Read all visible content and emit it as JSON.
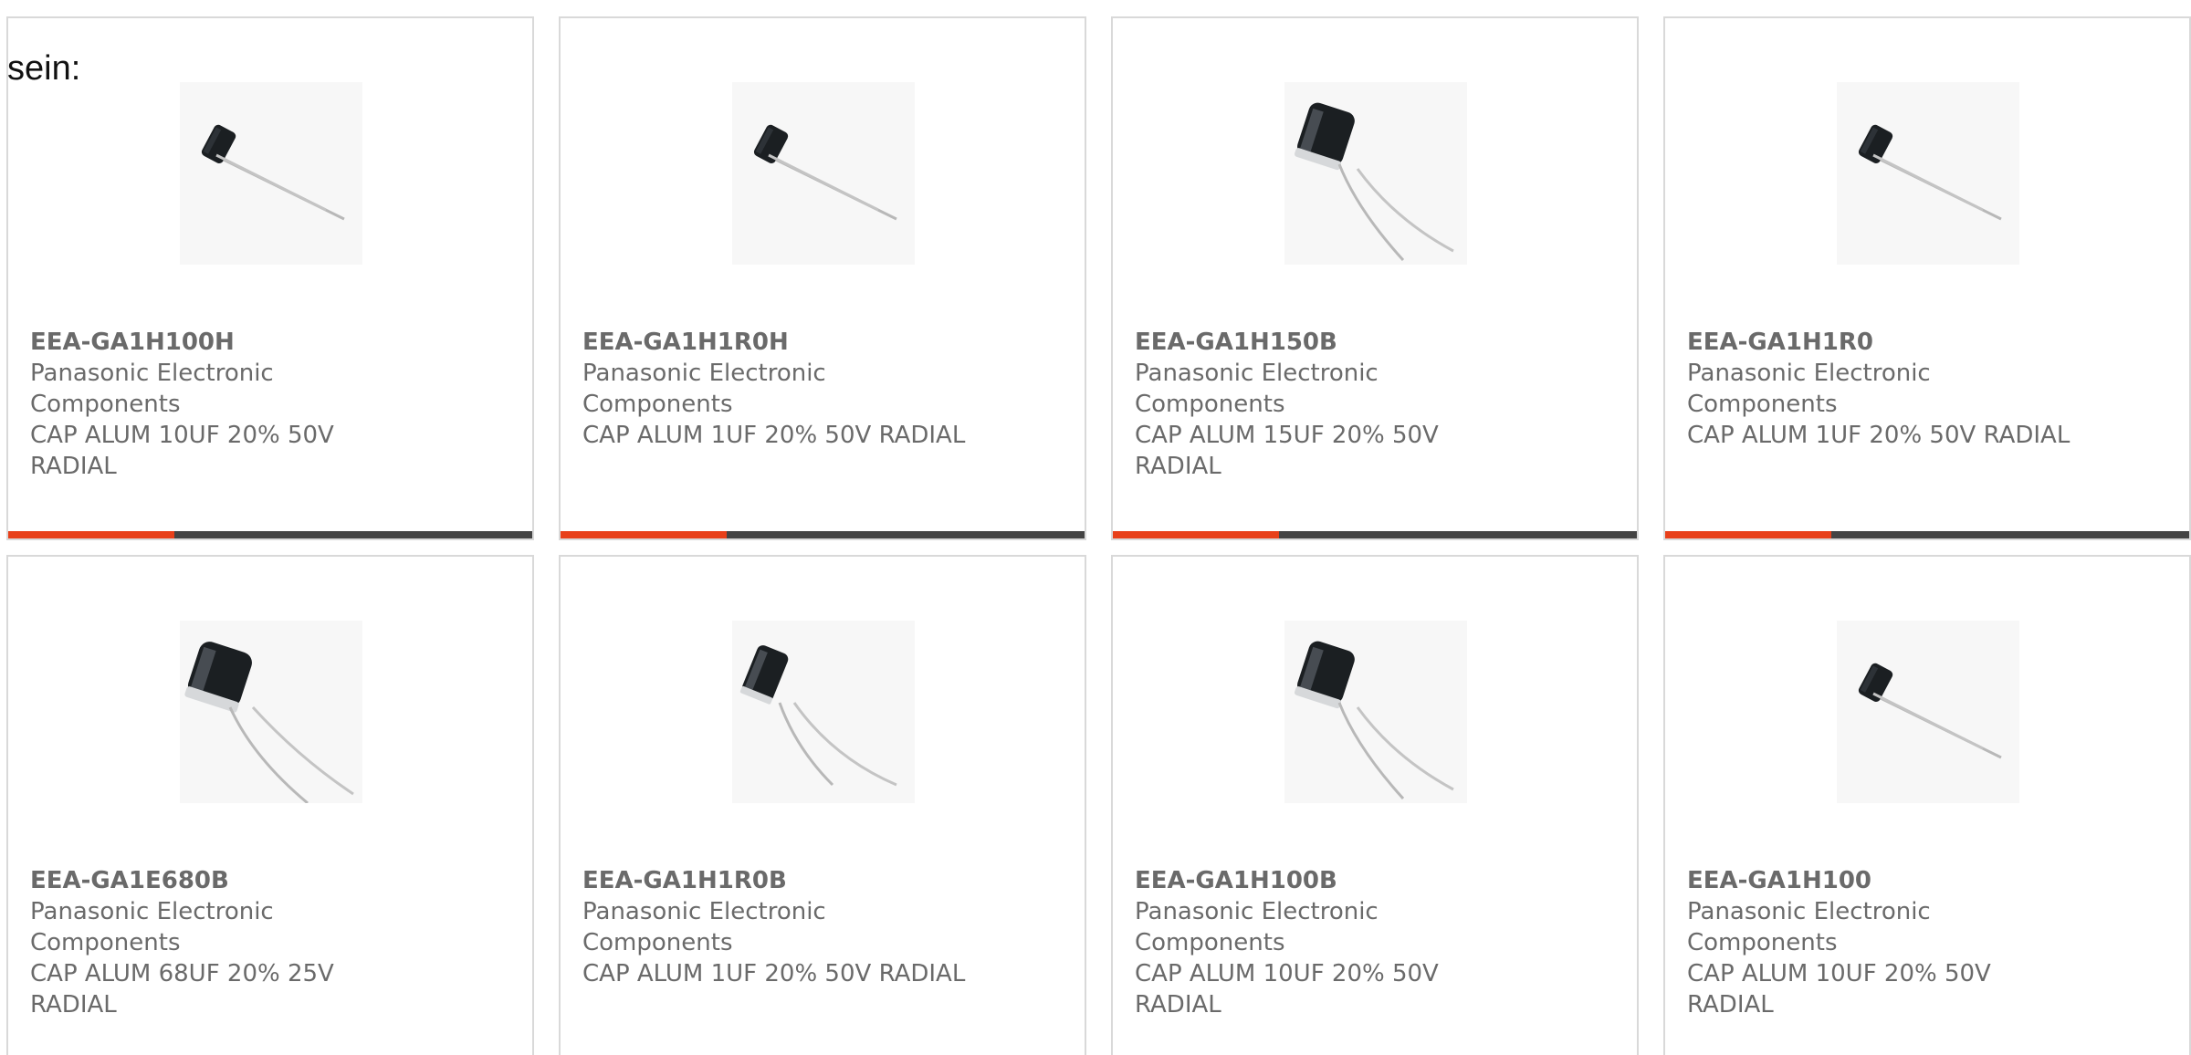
{
  "intro": {
    "text": "sein:"
  },
  "colors": {
    "accent": "#e8401a",
    "bar": "#444444",
    "text": "#6a6a6a",
    "border": "#d9d9d9"
  },
  "products": [
    {
      "part_number": "EEA-GA1H100H",
      "manufacturer": "Panasonic Electronic Components",
      "description": "CAP ALUM 10UF 20% 50V RADIAL",
      "image": "small-radial-capacitor"
    },
    {
      "part_number": "EEA-GA1H1R0H",
      "manufacturer": "Panasonic Electronic Components",
      "description": "CAP ALUM 1UF 20% 50V RADIAL",
      "image": "small-radial-capacitor"
    },
    {
      "part_number": "EEA-GA1H150B",
      "manufacturer": "Panasonic Electronic Components",
      "description": "CAP ALUM 15UF 20% 50V RADIAL",
      "image": "large-radial-capacitor"
    },
    {
      "part_number": "EEA-GA1H1R0",
      "manufacturer": "Panasonic Electronic Components",
      "description": "CAP ALUM 1UF 20% 50V RADIAL",
      "image": "small-radial-capacitor"
    },
    {
      "part_number": "EEA-GA1E680B",
      "manufacturer": "Panasonic Electronic Components",
      "description": "CAP ALUM 68UF 20% 25V RADIAL",
      "image": "large-radial-capacitor"
    },
    {
      "part_number": "EEA-GA1H1R0B",
      "manufacturer": "Panasonic Electronic Components",
      "description": "CAP ALUM 1UF 20% 50V RADIAL",
      "image": "medium-radial-capacitor"
    },
    {
      "part_number": "EEA-GA1H100B",
      "manufacturer": "Panasonic Electronic Components",
      "description": "CAP ALUM 10UF 20% 50V RADIAL",
      "image": "large-radial-capacitor"
    },
    {
      "part_number": "EEA-GA1H100",
      "manufacturer": "Panasonic Electronic Components",
      "description": "CAP ALUM 10UF 20% 50V RADIAL",
      "image": "small-radial-capacitor"
    }
  ]
}
